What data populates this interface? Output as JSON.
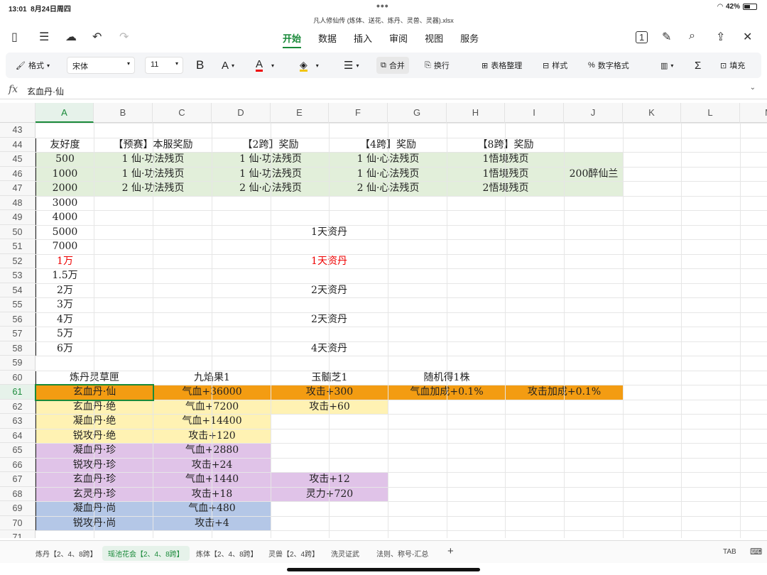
{
  "status": {
    "time": "13:01",
    "date": "8月24日周四",
    "battery": "42%"
  },
  "file": {
    "title": "凡人修仙传 (炼体、送花、炼丹、灵兽、灵器).xlsx"
  },
  "menu": [
    "开始",
    "数据",
    "插入",
    "审阅",
    "视图",
    "服务"
  ],
  "toolbar": {
    "format": "格式",
    "font": "宋体",
    "size": "11",
    "bold": "B",
    "fontsize_icon": "A",
    "color_a": "A",
    "merge": "合并",
    "wrap": "换行",
    "organize": "表格整理",
    "style": "样式",
    "numfmt": "数字格式",
    "fill": "填充"
  },
  "formula": {
    "fx": "fx",
    "value": "玄血丹·仙"
  },
  "columns": [
    "A",
    "B",
    "C",
    "D",
    "E",
    "F",
    "G",
    "H",
    "I",
    "J",
    "K",
    "L",
    "M"
  ],
  "rows": [
    "43",
    "44",
    "45",
    "46",
    "47",
    "48",
    "49",
    "50",
    "51",
    "52",
    "53",
    "54",
    "55",
    "56",
    "57",
    "58",
    "59",
    "60",
    "61",
    "62",
    "63",
    "64",
    "65",
    "66",
    "67",
    "68",
    "69",
    "70",
    "71"
  ],
  "table1": {
    "headers": [
      "友好度",
      "【预赛】本服奖励",
      "【2跨】奖励",
      "【4跨】奖励",
      "【8跨】奖励"
    ],
    "rows": [
      [
        "500",
        "1 仙·功法残页",
        "1 仙·功法残页",
        "1 仙·心法残页",
        "1悟境残页"
      ],
      [
        "1000",
        "1 仙·功法残页",
        "1 仙·功法残页",
        "1 仙·心法残页",
        "1悟境残页"
      ],
      [
        "2000",
        "2 仙·功法残页",
        "2 仙·心法残页",
        "2 仙·心法残页",
        "2悟境残页"
      ]
    ],
    "extra": "200醉仙兰",
    "levels": [
      "3000",
      "4000",
      "5000",
      "7000",
      "1万",
      "1.5万",
      "2万",
      "3万",
      "4万",
      "5万",
      "6万"
    ],
    "merged": [
      "",
      "",
      "1天资丹",
      "",
      "1天资丹",
      "",
      "2天资丹",
      "",
      "2天资丹",
      "",
      "4天资丹"
    ]
  },
  "table2": {
    "headers": [
      "炼丹灵草匣",
      "九焰果1",
      "玉髓芝1",
      "随机得1株"
    ],
    "rows": [
      [
        "玄血丹·仙",
        "气血+36000",
        "攻击+300",
        "气血加成+0.1%",
        "攻击加成+0.1%"
      ],
      [
        "玄血丹·绝",
        "气血+7200",
        "攻击+60"
      ],
      [
        "凝血丹·绝",
        "气血+14400"
      ],
      [
        "锐攻丹·绝",
        "攻击+120"
      ],
      [
        "凝血丹·珍",
        "气血+2880"
      ],
      [
        "锐攻丹·珍",
        "攻击+24"
      ],
      [
        "玄血丹·珍",
        "气血+1440",
        "攻击+12"
      ],
      [
        "玄灵丹·珍",
        "攻击+18",
        "灵力+720"
      ],
      [
        "凝血丹·尚",
        "气血+480"
      ],
      [
        "锐攻丹·尚",
        "攻击+4"
      ]
    ]
  },
  "sheets": [
    "炼丹【2、4、8跨】",
    "瑶池花会【2、4、8跨】",
    "炼体【2、4、8跨】",
    "灵兽【2、4跨】",
    "洗灵证武",
    "法则、称号-汇总"
  ],
  "bottom": {
    "tab_key": "TAB"
  }
}
